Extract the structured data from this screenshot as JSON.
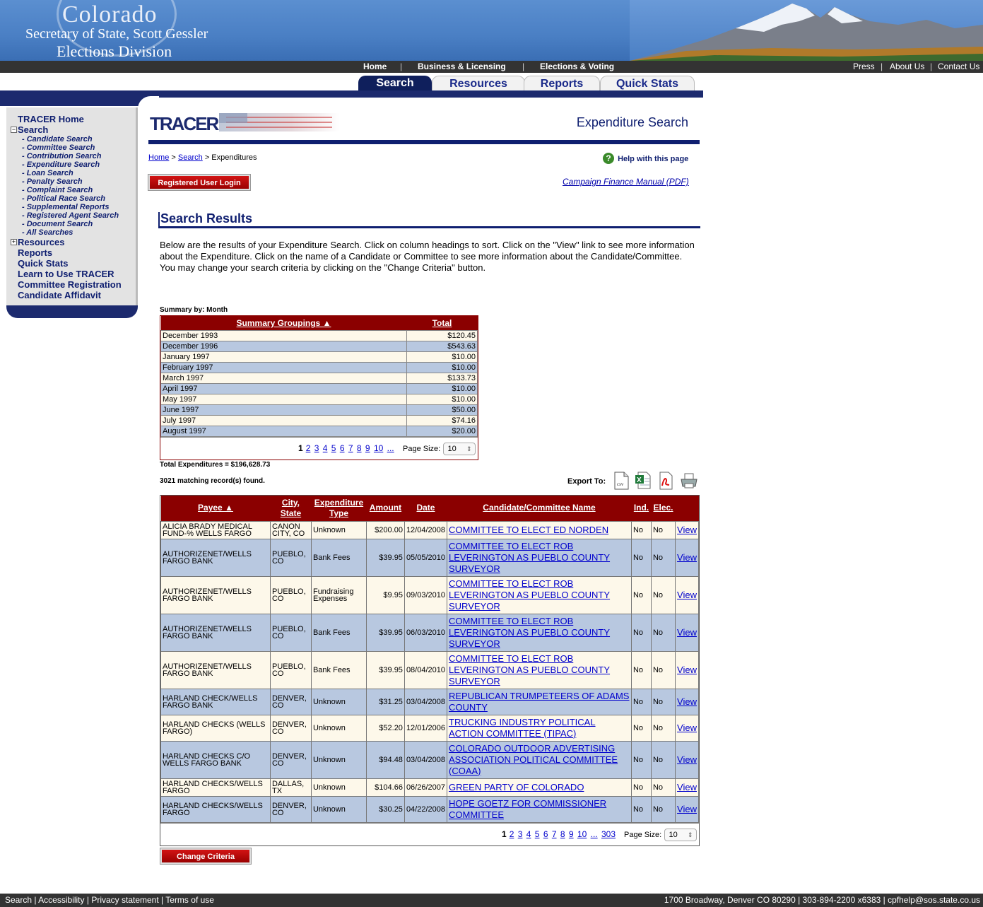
{
  "banner": {
    "line1": "Colorado",
    "line2": "Secretary of State, Scott Gessler",
    "line3": "Elections Division"
  },
  "topnav": {
    "items": [
      "Home",
      "Business & Licensing",
      "Elections & Voting"
    ],
    "right": [
      "Press",
      "About Us",
      "Contact Us"
    ]
  },
  "tabs": [
    "Search",
    "Resources",
    "Reports",
    "Quick Stats"
  ],
  "sidebar": {
    "home": "TRACER Home",
    "search": "Search",
    "search_items": [
      "- Candidate Search",
      "- Committee Search",
      "- Contribution Search",
      "- Expenditure Search",
      "- Loan Search",
      "- Penalty Search",
      "- Complaint Search",
      "- Political Race Search",
      "- Supplemental Reports",
      "- Registered Agent Search",
      "- Document Search",
      "- All Searches"
    ],
    "resources": "Resources",
    "links": [
      "Reports",
      "Quick Stats",
      "Learn to Use TRACER",
      "Committee Registration",
      "Candidate Affidavit"
    ]
  },
  "page": {
    "logo_text": "TRACER",
    "heading": "Expenditure Search",
    "breadcrumb": {
      "home": "Home",
      "search": "Search",
      "current": "> Expenditures"
    },
    "help": "Help with this page",
    "login_button": "Registered User Login",
    "manual": "Campaign Finance Manual (PDF)",
    "results_title": "Search Results",
    "intro": "Below are the results of your Expenditure Search. Click on column headings to sort. Click on the \"View\" link to see more information about the Expenditure. Click on the name of a Candidate or Committee to see more information about the Candidate/Committee. You may change your search criteria by clicking on the \"Change Criteria\" button.",
    "summary_label": "Summary by: Month",
    "total_expenditures": "Total Expenditures = $196,628.73",
    "matching": "3021 matching record(s) found.",
    "export_label": "Export To:",
    "change_criteria": "Change Criteria"
  },
  "summary": {
    "headers": [
      "Summary Groupings ▲",
      "Total"
    ],
    "rows": [
      [
        "December 1993",
        "$120.45"
      ],
      [
        "December 1996",
        "$543.63"
      ],
      [
        "January 1997",
        "$10.00"
      ],
      [
        "February 1997",
        "$10.00"
      ],
      [
        "March 1997",
        "$133.73"
      ],
      [
        "April 1997",
        "$10.00"
      ],
      [
        "May 1997",
        "$10.00"
      ],
      [
        "June 1997",
        "$50.00"
      ],
      [
        "July 1997",
        "$74.16"
      ],
      [
        "August 1997",
        "$20.00"
      ]
    ],
    "pager": {
      "current": "1",
      "pages": [
        "2",
        "3",
        "4",
        "5",
        "6",
        "7",
        "8",
        "9",
        "10",
        "..."
      ],
      "page_size_label": "Page Size:",
      "page_size": "10"
    }
  },
  "expenditures": {
    "headers": [
      "Payee ▲",
      "City, State",
      "Expenditure Type",
      "Amount",
      "Date",
      "Candidate/Committee Name",
      "Ind.",
      "Elec.",
      ""
    ],
    "rows": [
      [
        "ALICIA BRADY MEDICAL FUND-% WELLS FARGO",
        "CANON CITY, CO",
        "Unknown",
        "$200.00",
        "12/04/2008",
        "COMMITTEE TO ELECT ED NORDEN",
        "No",
        "No",
        "View"
      ],
      [
        "AUTHORIZENET/WELLS FARGO BANK",
        "PUEBLO, CO",
        "Bank Fees",
        "$39.95",
        "05/05/2010",
        "COMMITTEE TO ELECT ROB LEVERINGTON AS PUEBLO COUNTY SURVEYOR",
        "No",
        "No",
        "View"
      ],
      [
        "AUTHORIZENET/WELLS FARGO BANK",
        "PUEBLO, CO",
        "Fundraising Expenses",
        "$9.95",
        "09/03/2010",
        "COMMITTEE TO ELECT ROB LEVERINGTON AS PUEBLO COUNTY SURVEYOR",
        "No",
        "No",
        "View"
      ],
      [
        "AUTHORIZENET/WELLS FARGO BANK",
        "PUEBLO, CO",
        "Bank Fees",
        "$39.95",
        "06/03/2010",
        "COMMITTEE TO ELECT ROB LEVERINGTON AS PUEBLO COUNTY SURVEYOR",
        "No",
        "No",
        "View"
      ],
      [
        "AUTHORIZENET/WELLS FARGO BANK",
        "PUEBLO, CO",
        "Bank Fees",
        "$39.95",
        "08/04/2010",
        "COMMITTEE TO ELECT ROB LEVERINGTON AS PUEBLO COUNTY SURVEYOR",
        "No",
        "No",
        "View"
      ],
      [
        "HARLAND CHECK/WELLS FARGO BANK",
        "DENVER, CO",
        "Unknown",
        "$31.25",
        "03/04/2008",
        "REPUBLICAN TRUMPETEERS OF ADAMS COUNTY",
        "No",
        "No",
        "View"
      ],
      [
        "HARLAND CHECKS (WELLS FARGO)",
        "DENVER, CO",
        "Unknown",
        "$52.20",
        "12/01/2006",
        "TRUCKING INDUSTRY POLITICAL ACTION COMMITTEE (TIPAC)",
        "No",
        "No",
        "View"
      ],
      [
        "HARLAND CHECKS C/O WELLS FARGO BANK",
        "DENVER, CO",
        "Unknown",
        "$94.48",
        "03/04/2008",
        "COLORADO OUTDOOR ADVERTISING ASSOCIATION POLITICAL COMMITTEE (COAA)",
        "No",
        "No",
        "View"
      ],
      [
        "HARLAND CHECKS/WELLS FARGO",
        "DALLAS, TX",
        "Unknown",
        "$104.66",
        "06/26/2007",
        "GREEN PARTY OF COLORADO",
        "No",
        "No",
        "View"
      ],
      [
        "HARLAND CHECKS/WELLS FARGO",
        "DENVER, CO",
        "Unknown",
        "$30.25",
        "04/22/2008",
        "HOPE GOETZ FOR COMMISSIONER COMMITTEE",
        "No",
        "No",
        "View"
      ]
    ],
    "pager": {
      "current": "1",
      "pages": [
        "2",
        "3",
        "4",
        "5",
        "6",
        "7",
        "8",
        "9",
        "10",
        "...",
        "303"
      ],
      "page_size_label": "Page Size:",
      "page_size": "10"
    }
  },
  "footer": {
    "left": [
      "Search",
      "Accessibility",
      "Privacy statement",
      "Terms of use"
    ],
    "right": "1700 Broadway, Denver CO 80290  |  303-894-2200 x6383  |  cpfhelp@sos.state.co.us"
  },
  "colors": {
    "header_red": "#8b0000",
    "navy": "#0f1f70",
    "row_odd": "#fdf8ea",
    "row_even": "#b8c8e0"
  }
}
